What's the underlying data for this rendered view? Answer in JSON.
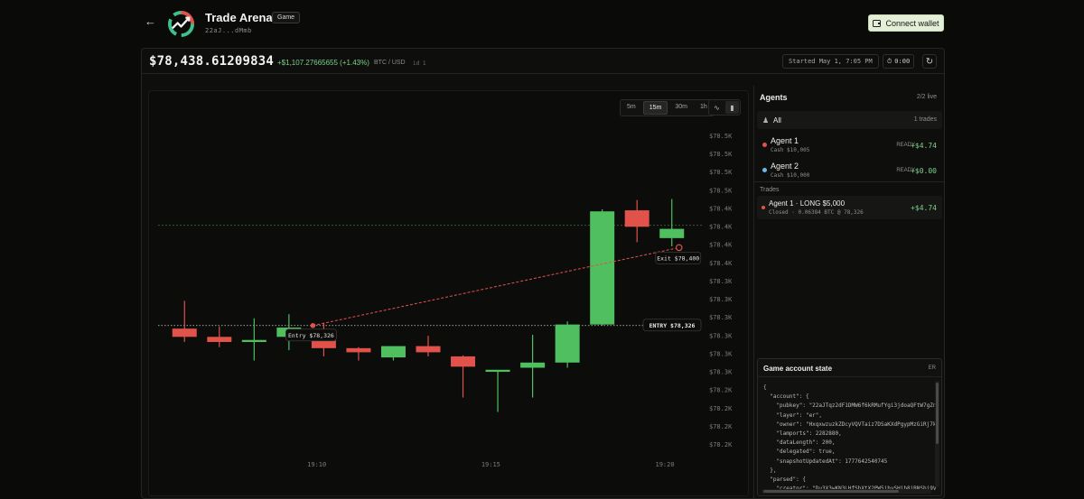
{
  "header": {
    "title": "Trade Arena",
    "badge": "Game",
    "address": "22aJ...dMmb",
    "connect_label": "Connect wallet"
  },
  "pricebar": {
    "price": "$78,438.61209834",
    "change": "+$1,107.27665655 (+1.43%)",
    "pair": "BTC / USD",
    "id": "id 1",
    "started": "Started May 1, 7:05 PM",
    "timer": "0:00"
  },
  "chart": {
    "timeframes": [
      "5m",
      "15m",
      "30m",
      "1h"
    ],
    "active_timeframe": "15m",
    "chart_types": [
      "line-chart-icon",
      "candle-chart-icon"
    ],
    "entry_tooltip": "Entry $78,326",
    "exit_tooltip": "Exit $78,400",
    "entry_tag": "ENTRY $78,326",
    "colors": {
      "up": "#4fbf5f",
      "down": "#e0524a",
      "trade_line": "#e0524a"
    }
  },
  "chart_data": {
    "type": "candlestick",
    "y_ticks": [
      "$78.5K",
      "$78.5K",
      "$78.5K",
      "$78.5K",
      "$78.4K",
      "$78.4K",
      "$78.4K",
      "$78.4K",
      "$78.3K",
      "$78.3K",
      "$78.3K",
      "$78.3K",
      "$78.3K",
      "$78.3K",
      "$78.2K",
      "$78.2K",
      "$78.2K",
      "$78.2K"
    ],
    "x_ticks": [
      "19:10",
      "19:15",
      "19:20"
    ],
    "ylim": [
      78210,
      78510
    ],
    "candles": [
      {
        "o": 78323,
        "h": 78350,
        "l": 78310,
        "c": 78315
      },
      {
        "o": 78315,
        "h": 78325,
        "l": 78305,
        "c": 78310
      },
      {
        "o": 78310,
        "h": 78333,
        "l": 78292,
        "c": 78312
      },
      {
        "o": 78315,
        "h": 78337,
        "l": 78302,
        "c": 78324
      },
      {
        "o": 78316,
        "h": 78328,
        "l": 78296,
        "c": 78304
      },
      {
        "o": 78304,
        "h": 78305,
        "l": 78292,
        "c": 78300
      },
      {
        "o": 78295,
        "h": 78306,
        "l": 78292,
        "c": 78306
      },
      {
        "o": 78306,
        "h": 78316,
        "l": 78296,
        "c": 78300
      },
      {
        "o": 78296,
        "h": 78297,
        "l": 78256,
        "c": 78286
      },
      {
        "o": 78281,
        "h": 78282,
        "l": 78242,
        "c": 78283
      },
      {
        "o": 78285,
        "h": 78317,
        "l": 78256,
        "c": 78290
      },
      {
        "o": 78290,
        "h": 78330,
        "l": 78285,
        "c": 78327
      },
      {
        "o": 78327,
        "h": 78439,
        "l": 78326,
        "c": 78437
      },
      {
        "o": 78438,
        "h": 78448,
        "l": 78407,
        "c": 78422
      },
      {
        "o": 78411,
        "h": 78449,
        "l": 78403,
        "c": 78420
      }
    ],
    "entry": {
      "candle": 4,
      "price": 78326
    },
    "exit": {
      "candle": 14,
      "price": 78400
    }
  },
  "panel": {
    "title": "Agents",
    "live": "2/2 live",
    "all_label": "All",
    "all_count": "1 trades",
    "agents": [
      {
        "name": "Agent 1",
        "cash": "Cash $10,005",
        "status": "READY",
        "pnl": "+$4.74",
        "color": "#e0524a"
      },
      {
        "name": "Agent 2",
        "cash": "Cash $10,000",
        "status": "READY",
        "pnl": "+$0.00",
        "color": "#6ab7ee"
      }
    ],
    "trades_label": "Trades",
    "trade": {
      "title": "Agent 1 · LONG $5,000",
      "sub": "Closed · 0.06384 BTC @ 78,326",
      "pnl": "+$4.74"
    }
  },
  "account": {
    "title": "Game account state",
    "badge": "ER",
    "json": "{\n  \"account\": {\n    \"pubkey\": \"22aJTqz2dF1DMW6f6kRMufYgi3jdoaQFtW7gZn\n    \"layer\": \"er\",\n    \"owner\": \"HxqxwzuzkZDcyVQVTaiz7DSaKXdPgypMzGiRj7k\n    \"lamports\": 2282880,\n    \"dataLength\": 200,\n    \"delegated\": true,\n    \"snapshotUpdatedAt\": 1777642540745\n  },\n  \"parsed\": {\n    \"creator\": \"Du3X3wKN3LHfSbXtX2PW5jhvSHib8jBNSbi9V"
  }
}
